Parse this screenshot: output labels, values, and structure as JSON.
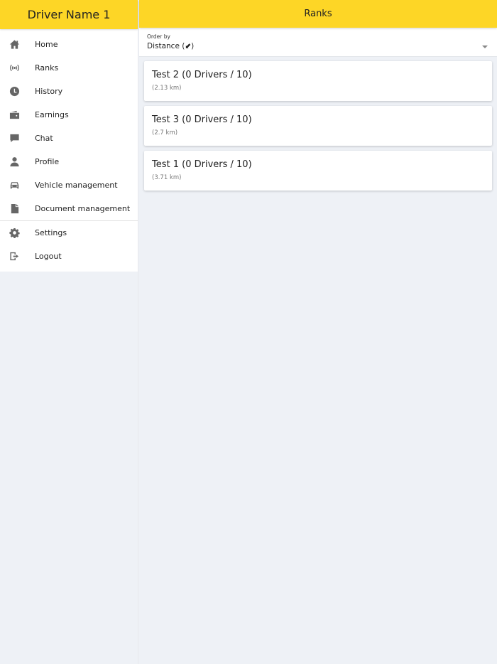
{
  "sidebar": {
    "driver_name": "Driver Name 1",
    "items": [
      {
        "label": "Home",
        "icon": "home-icon"
      },
      {
        "label": "Ranks",
        "icon": "broadcast-icon"
      },
      {
        "label": "History",
        "icon": "clock-icon"
      },
      {
        "label": "Earnings",
        "icon": "wallet-icon"
      },
      {
        "label": "Chat",
        "icon": "chat-bubble-icon"
      },
      {
        "label": "Profile",
        "icon": "person-icon"
      },
      {
        "label": "Vehicle management",
        "icon": "car-icon"
      },
      {
        "label": "Document management",
        "icon": "document-icon"
      }
    ],
    "footer_items": [
      {
        "label": "Settings",
        "icon": "gear-icon"
      },
      {
        "label": "Logout",
        "icon": "logout-icon"
      }
    ]
  },
  "header": {
    "title": "Ranks"
  },
  "order": {
    "label": "Order by",
    "value": "Distance (⬋)"
  },
  "ranks": [
    {
      "title": "Test 2 (0 Drivers / 10)",
      "distance": "(2.13 km)"
    },
    {
      "title": "Test 3 (0 Drivers / 10)",
      "distance": "(2.7 km)"
    },
    {
      "title": "Test 1 (0 Drivers / 10)",
      "distance": "(3.71 km)"
    }
  ],
  "colors": {
    "accent": "#fdd626",
    "background": "#eef1f6",
    "icon": "#666666"
  }
}
